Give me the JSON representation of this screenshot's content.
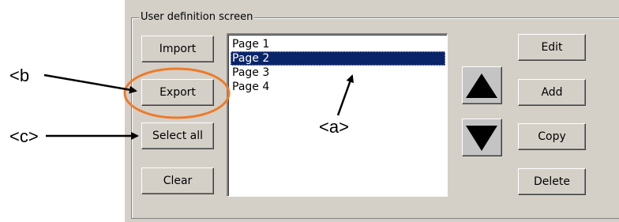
{
  "group": {
    "title": "User definition screen"
  },
  "left_buttons": {
    "import": "Import",
    "export": "Export",
    "select_all": "Select all",
    "clear": "Clear"
  },
  "pages": {
    "items": [
      "Page 1",
      "Page 2",
      "Page 3",
      "Page 4"
    ],
    "selected_index": 1
  },
  "right_buttons": {
    "edit": "Edit",
    "add": "Add",
    "copy": "Copy",
    "delete": "Delete"
  },
  "arrows": {
    "up_icon": "triangle-up-icon",
    "down_icon": "triangle-down-icon"
  },
  "annotations": {
    "a": "<a>",
    "b": "<b",
    "c": "<c>"
  },
  "colors": {
    "selection": "#0a246a",
    "highlight_ring": "#ee7a2a",
    "panel": "#d4d0c8"
  }
}
